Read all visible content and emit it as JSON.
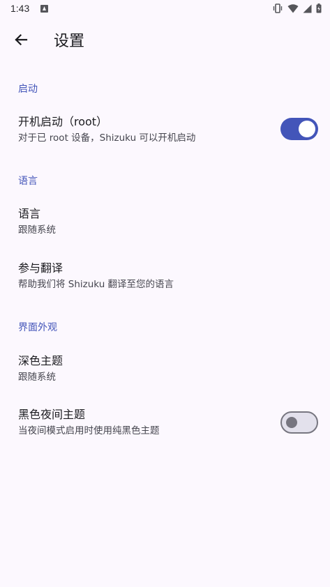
{
  "status_bar": {
    "time": "1:43",
    "icons": [
      "notification-icon",
      "vibrate-icon",
      "wifi-icon",
      "signal-icon",
      "battery-charging-icon"
    ]
  },
  "app_bar": {
    "back_icon": "arrow-back-icon",
    "title": "设置"
  },
  "colors": {
    "accent": "#4355B9",
    "background": "#FCF8FE",
    "switch_off_track": "#E3E1EC",
    "switch_off_thumb": "#777680"
  },
  "sections": {
    "startup": {
      "header": "启动",
      "boot_start": {
        "title": "开机启动（root）",
        "summary": "对于已 root 设备，Shizuku 可以开机启动",
        "enabled": true
      }
    },
    "language": {
      "header": "语言",
      "language": {
        "title": "语言",
        "summary": "跟随系统"
      },
      "translate": {
        "title": "参与翻译",
        "summary": "帮助我们将 Shizuku 翻译至您的语言"
      }
    },
    "appearance": {
      "header": "界面外观",
      "dark_theme": {
        "title": "深色主题",
        "summary": "跟随系统"
      },
      "black_night": {
        "title": "黑色夜间主题",
        "summary": "当夜间模式启用时使用纯黑色主题",
        "enabled": false
      }
    }
  }
}
